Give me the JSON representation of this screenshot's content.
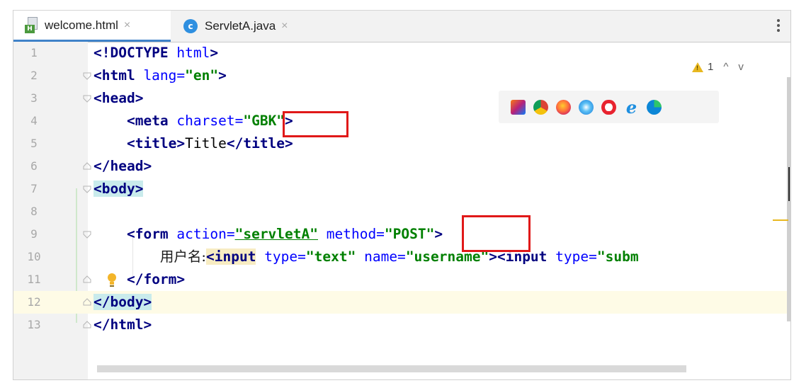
{
  "tabs": [
    {
      "label": "welcome.html",
      "icon": "html-file-icon",
      "badge": "H",
      "close": "×",
      "active": true
    },
    {
      "label": "ServletA.java",
      "icon": "java-class-icon",
      "badge": "c",
      "close": "×",
      "active": false
    }
  ],
  "inspection": {
    "warning_count": "1",
    "up": "^",
    "down": "v"
  },
  "line_numbers": [
    "1",
    "2",
    "3",
    "4",
    "5",
    "6",
    "7",
    "8",
    "9",
    "10",
    "11",
    "12",
    "13"
  ],
  "code": {
    "l1": {
      "open": "<!DOCTYPE",
      "rest": " html",
      "close": ">"
    },
    "l2": {
      "tag": "<html",
      "attr": " lang=",
      "val": "\"en\"",
      "close": ">"
    },
    "l3": {
      "tag": "<head>"
    },
    "l4": {
      "tag": "<meta",
      "attr": " charset=",
      "val": "\"GBK\"",
      "close": ">"
    },
    "l5": {
      "open": "<title>",
      "text": "Title",
      "close": "</title>"
    },
    "l6": {
      "tag": "</head>"
    },
    "l7": {
      "tag": "<body>"
    },
    "l9": {
      "tag": "<form",
      "attr1": " action=",
      "val1": "\"servletA\"",
      "attr2": " method=",
      "val2": "\"POST\"",
      "close": ">"
    },
    "l10": {
      "label": "用户名:",
      "tag1": "<input",
      "attr1": " type=",
      "val1": "\"text\"",
      "attr2": " name=",
      "val2": "\"username\"",
      "close1": ">",
      "tag2": "<input",
      "attr3": " type=",
      "val3": "\"subm"
    },
    "l11": {
      "tag": "</form>"
    },
    "l12": {
      "tag": "</body>"
    },
    "l13": {
      "tag": "</html>"
    }
  },
  "browsers": [
    "intellij-icon",
    "chrome-icon",
    "firefox-icon",
    "safari-icon",
    "opera-icon",
    "ie-icon",
    "edge-icon"
  ],
  "colors": {
    "tag": "#000080",
    "attribute": "#0000ff",
    "value": "#008000",
    "annotation_box": "#e01919",
    "current_line": "#fefbe6",
    "gutter": "#f2f2f2",
    "warning": "#e8b820"
  }
}
